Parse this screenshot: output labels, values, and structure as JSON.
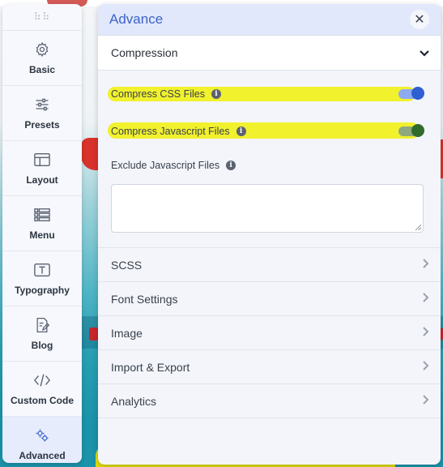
{
  "sidebar": {
    "handle": "⠷⠷",
    "items": [
      {
        "label": "Basic",
        "icon": "gear-icon"
      },
      {
        "label": "Presets",
        "icon": "sliders-icon"
      },
      {
        "label": "Layout",
        "icon": "layout-icon"
      },
      {
        "label": "Menu",
        "icon": "menu-icon"
      },
      {
        "label": "Typography",
        "icon": "typography-icon"
      },
      {
        "label": "Blog",
        "icon": "blog-icon"
      },
      {
        "label": "Custom Code",
        "icon": "code-icon"
      },
      {
        "label": "Advanced",
        "icon": "advanced-icon",
        "active": true
      }
    ]
  },
  "panel": {
    "title": "Advance",
    "close_symbol": "✕",
    "compression": {
      "title": "Compression",
      "expanded": true,
      "compress_css_label": "Compress CSS Files",
      "compress_css_on": true,
      "compress_js_label": "Compress Javascript Files",
      "compress_js_on": true,
      "exclude_js_label": "Exclude Javascript Files",
      "exclude_js_value": ""
    },
    "sections": [
      {
        "label": "SCSS"
      },
      {
        "label": "Font Settings"
      },
      {
        "label": "Image"
      },
      {
        "label": "Import & Export"
      },
      {
        "label": "Analytics"
      }
    ]
  },
  "colors": {
    "accent": "#3b63c8",
    "toggle_css_knob": "#2f5fd0",
    "toggle_js_knob": "#2f6b2a",
    "highlight": "#f0f000"
  }
}
